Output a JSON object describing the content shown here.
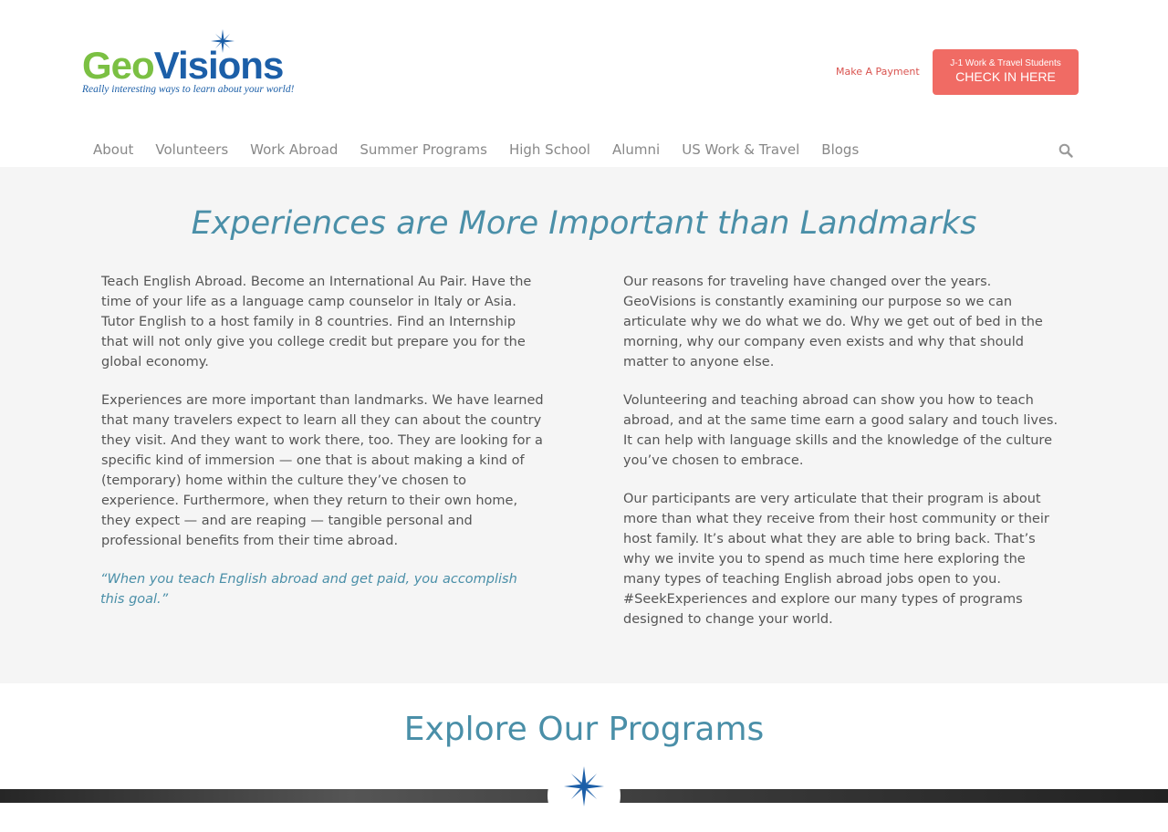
{
  "brand": {
    "word_part1": "Geo",
    "word_part2": "Visions",
    "tagline": "Really interesting ways to learn about your world!",
    "colors": {
      "green": "#7bc043",
      "blue": "#1c5fa8",
      "accent": "#f06b64",
      "teal": "#4a8fa8"
    }
  },
  "header": {
    "payment_link": "Make A Payment",
    "checkin": {
      "small": "J-1 Work & Travel Students",
      "big": "CHECK IN HERE"
    }
  },
  "nav": {
    "items": [
      "About",
      "Volunteers",
      "Work Abroad",
      "Summer Programs",
      "High School",
      "Alumni",
      "US Work & Travel",
      "Blogs"
    ],
    "search_icon": "search-icon"
  },
  "main": {
    "headline": "Experiences are More Important than Landmarks",
    "left": {
      "p1": "Teach English Abroad.  Become an International Au Pair.  Have the time of your life as a language camp counselor in Italy or Asia.  Tutor English to a host family in 8 countries.  Find an Internship that will not only give you college credit but prepare you for the global economy.",
      "p2": "Experiences are more important than landmarks.  We have learned that many travelers expect to learn all they can about the country they visit. And they want to work there, too. They are looking for a specific kind of immersion — one that is about making a kind of (temporary) home within the culture they’ve chosen to experience.  Furthermore, when they return to their own home, they expect — and are reaping — tangible personal and professional benefits from their time abroad.",
      "quote": "“When you teach English abroad and get paid, you accomplish this goal.”"
    },
    "right": {
      "p1": "Our reasons for traveling have changed over the years.  GeoVisions is constantly examining our purpose so we can articulate why we do what we do. Why we get out of bed in the morning, why our company even exists and why that should matter to anyone else.",
      "p2": "Volunteering and teaching abroad can show you how to teach abroad, and at the same time earn a good salary and touch lives.  It can help with language skills and the knowledge of the culture you’ve chosen to embrace.",
      "p3": "Our participants are very articulate that their program is about more than what they receive from their host community or their host family.  It’s about what they are able to bring back. That’s why we invite you to spend as much time here exploring the many types of teaching English abroad jobs open to you.  #SeekExperiences and explore our many types of programs designed to change your world."
    }
  },
  "explore": {
    "title": "Explore Our Programs",
    "badge_icon": "compass-star-icon"
  }
}
